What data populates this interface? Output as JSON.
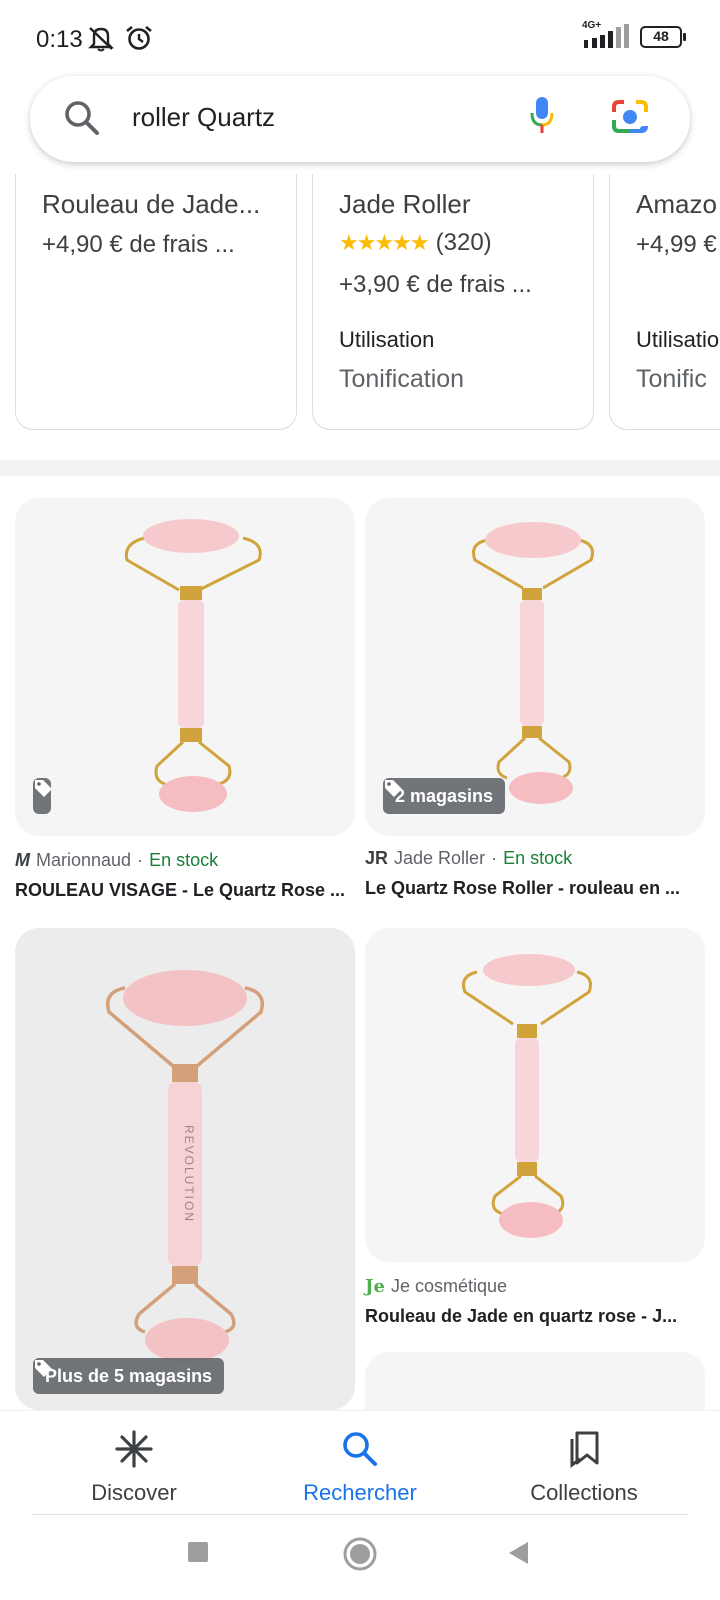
{
  "status_bar": {
    "time": "0:13",
    "network": "4G+",
    "battery": "48",
    "icons": [
      "notifications-off-icon",
      "alarm-icon",
      "signal-icon",
      "battery-icon"
    ]
  },
  "search": {
    "query": "roller Quartz",
    "icons": [
      "search-icon",
      "mic-icon",
      "lens-icon"
    ]
  },
  "store_cards": [
    {
      "name": "Rouleau de Jade...",
      "shipping": "+4,90 € de frais ..."
    },
    {
      "name": "Jade Roller",
      "stars": "★★★★★",
      "rating_count": "(320)",
      "shipping": "+3,90 € de frais ...",
      "usage_label": "Utilisation",
      "usage_value": "Tonification"
    },
    {
      "name": "Amazo",
      "shipping": "+4,99 €",
      "usage_label": "Utilisatio",
      "usage_value": "Tonific"
    }
  ],
  "products": [
    {
      "merchant_logo": "M",
      "merchant": "Marionnaud",
      "separator": "·",
      "stock": "En stock",
      "title": "ROULEAU VISAGE - Le Quartz Rose ...",
      "badge": ""
    },
    {
      "merchant_logo": "JR",
      "merchant": "Jade Roller",
      "separator": "·",
      "stock": "En stock",
      "title": "Le Quartz Rose Roller - rouleau en ...",
      "badge": "2 magasins"
    },
    {
      "badge": "Plus de 5 magasins",
      "product_brand_text": "REVOLUTION"
    },
    {
      "merchant_logo": "Je",
      "merchant": "Je cosmétique",
      "title": "Rouleau de Jade en quartz rose - J..."
    }
  ],
  "bottom_nav": [
    {
      "label": "Discover",
      "icon": "discover-icon",
      "active": false
    },
    {
      "label": "Rechercher",
      "icon": "search-icon",
      "active": true
    },
    {
      "label": "Collections",
      "icon": "collections-icon",
      "active": false
    }
  ],
  "system_nav": [
    "recents-icon",
    "home-icon",
    "back-icon"
  ],
  "colors": {
    "accent": "#1a73e8",
    "in_stock": "#188038",
    "stars": "#fbbc04",
    "quartz_pink": "#f6c9cc"
  }
}
